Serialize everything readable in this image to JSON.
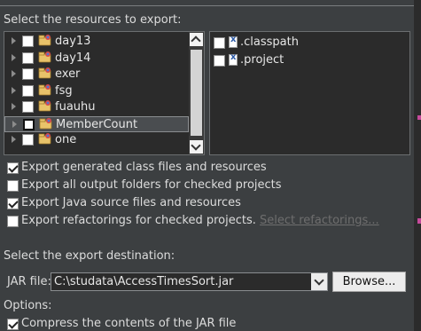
{
  "resources": {
    "heading": "Select the resources to export:",
    "projects": [
      {
        "label": "day13",
        "checked": false,
        "selected": false
      },
      {
        "label": "day14",
        "checked": false,
        "selected": false
      },
      {
        "label": "exer",
        "checked": false,
        "selected": false
      },
      {
        "label": "fsg",
        "checked": false,
        "selected": false
      },
      {
        "label": "fuauhu",
        "checked": false,
        "selected": false
      },
      {
        "label": "MemberCount",
        "checked": false,
        "selected": true
      },
      {
        "label": "one",
        "checked": false,
        "selected": false
      }
    ],
    "files": [
      {
        "label": ".classpath",
        "checked": false
      },
      {
        "label": ".project",
        "checked": false
      }
    ]
  },
  "export_options": {
    "class_files": {
      "label": "Export generated class files and resources",
      "checked": true
    },
    "output_folders": {
      "label": "Export all output folders for checked projects",
      "checked": false
    },
    "java_source": {
      "label": "Export Java source files and resources",
      "checked": true
    },
    "refactorings": {
      "label": "Export refactorings for checked projects.",
      "checked": false
    },
    "select_refactorings_link": "Select refactorings..."
  },
  "destination": {
    "heading": "Select the export destination:",
    "jar_label": "JAR file:",
    "jar_value": "C:\\studata\\AccessTimesSort.jar",
    "browse_label": "Browse..."
  },
  "options": {
    "heading": "Options:",
    "compress": {
      "label": "Compress the contents of the JAR file",
      "checked": true
    }
  },
  "colors": {
    "background": "#3c3f41",
    "panel": "#2b2b2b",
    "accent_tick": "#c64a9c"
  },
  "icons": {
    "tree_expand": "chevron-right-icon",
    "project": "java-project-icon",
    "file": "xml-file-icon"
  }
}
